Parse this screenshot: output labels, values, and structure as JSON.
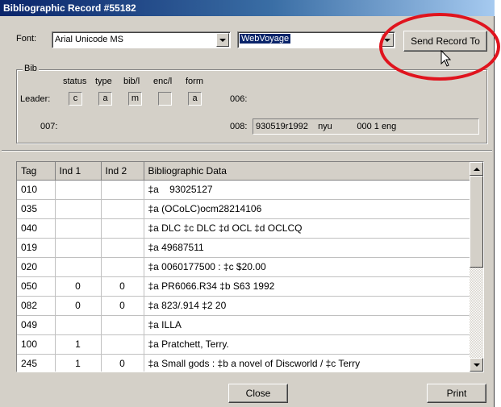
{
  "window": {
    "title": "Bibliographic Record #55182"
  },
  "font": {
    "label": "Font:",
    "value": "Arial Unicode MS"
  },
  "target": {
    "value": "WebVoyage"
  },
  "send_button": {
    "label": "Send Record To"
  },
  "bib": {
    "group_title": "Bib",
    "field_labels": [
      "status",
      "type",
      "bib/l",
      "enc/l",
      "form"
    ],
    "leader_label": "Leader:",
    "leader_values": [
      "c",
      "a",
      "m",
      "",
      "a"
    ],
    "f006_label": "006:",
    "f007_label": "007:",
    "f008_label": "008:",
    "f008_value": "930519r1992    nyu          000 1 eng"
  },
  "grid": {
    "headers": [
      "Tag",
      "Ind 1",
      "Ind 2",
      "Bibliographic Data"
    ],
    "rows": [
      {
        "tag": "010",
        "ind1": "",
        "ind2": "",
        "data": "‡a    93025127"
      },
      {
        "tag": "035",
        "ind1": "",
        "ind2": "",
        "data": "‡a (OCoLC)ocm28214106"
      },
      {
        "tag": "040",
        "ind1": "",
        "ind2": "",
        "data": "‡a DLC ‡c DLC ‡d OCL ‡d OCLCQ"
      },
      {
        "tag": "019",
        "ind1": "",
        "ind2": "",
        "data": "‡a 49687511"
      },
      {
        "tag": "020",
        "ind1": "",
        "ind2": "",
        "data": "‡a 0060177500 : ‡c $20.00"
      },
      {
        "tag": "050",
        "ind1": "0",
        "ind2": "0",
        "data": "‡a PR6066.R34 ‡b S63 1992"
      },
      {
        "tag": "082",
        "ind1": "0",
        "ind2": "0",
        "data": "‡a 823/.914 ‡2 20"
      },
      {
        "tag": "049",
        "ind1": "",
        "ind2": "",
        "data": "‡a ILLA"
      },
      {
        "tag": "100",
        "ind1": "1",
        "ind2": "",
        "data": "‡a Pratchett, Terry."
      },
      {
        "tag": "245",
        "ind1": "1",
        "ind2": "0",
        "data": "‡a Small gods : ‡b a novel of Discworld / ‡c Terry"
      }
    ]
  },
  "buttons": {
    "close": "Close",
    "print": "Print"
  },
  "annotation": {
    "highlight_color": "#e0141e"
  },
  "icons": {
    "dropdown": "chevron-down-icon",
    "cursor": "mouse-pointer-icon"
  }
}
